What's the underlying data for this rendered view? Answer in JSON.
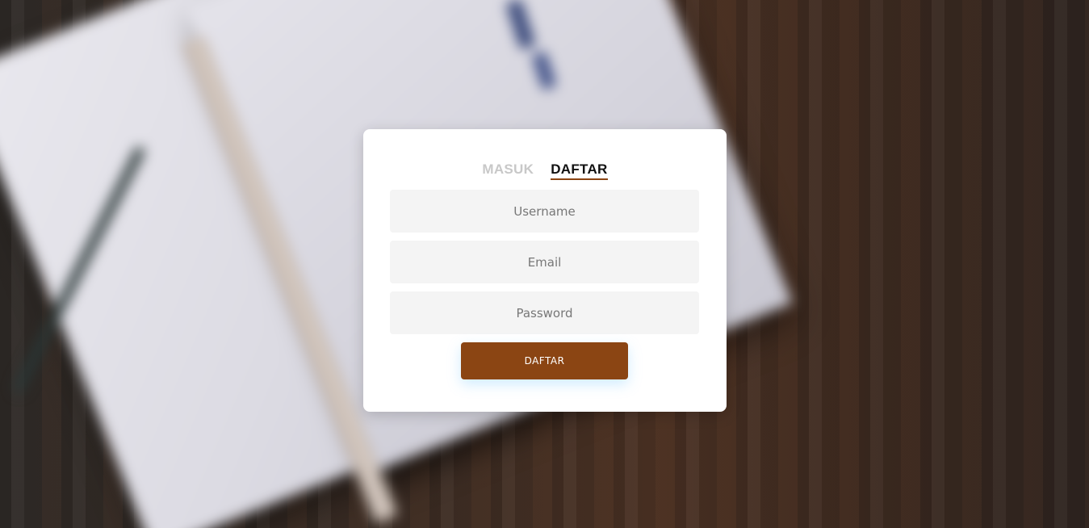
{
  "tabs": {
    "login_label": "MASUK",
    "register_label": "DAFTAR",
    "active": "register"
  },
  "form": {
    "username_placeholder": "Username",
    "email_placeholder": "Email",
    "password_placeholder": "Password",
    "submit_label": "DAFTAR"
  },
  "colors": {
    "accent": "#8b4513",
    "card": "#ffffff",
    "field_bg": "#f4f4f4",
    "inactive_tab": "#c8c8c8"
  }
}
